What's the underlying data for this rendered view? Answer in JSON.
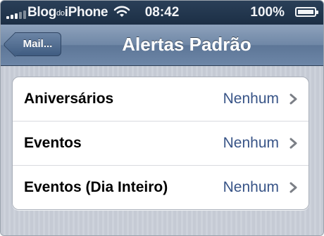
{
  "status_bar": {
    "carrier_prefix": "Blog",
    "carrier_small": "do",
    "carrier_suffix": "iPhone",
    "time": "08:42",
    "battery": "100%"
  },
  "nav": {
    "back_label": "Mail...",
    "title": "Alertas Padrão"
  },
  "rows": [
    {
      "label": "Aniversários",
      "value": "Nenhum"
    },
    {
      "label": "Eventos",
      "value": "Nenhum"
    },
    {
      "label": "Eventos (Dia Inteiro)",
      "value": "Nenhum"
    }
  ],
  "colors": {
    "value_text": "#385487",
    "nav_bar": "#6f87a6",
    "status_bar": "#1c2f45"
  }
}
